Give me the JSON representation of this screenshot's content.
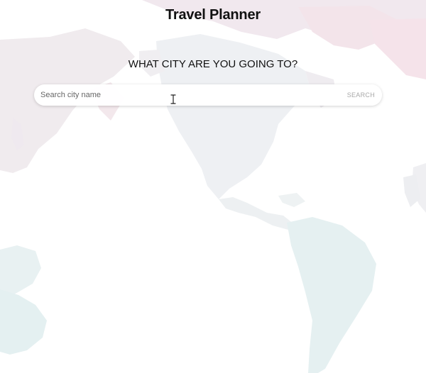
{
  "header": {
    "title": "Travel Planner"
  },
  "main": {
    "prompt": "WHAT CITY ARE YOU GOING TO?"
  },
  "search": {
    "placeholder": "Search city name",
    "button_label": "SEARCH"
  },
  "icons": {
    "cursor": "text-cursor-icon"
  },
  "colors": {
    "land_light": "#eef0f2",
    "land_pink": "#f4e6ea",
    "land_teal": "#e6f1f2",
    "button_text": "#a8a8a8"
  }
}
